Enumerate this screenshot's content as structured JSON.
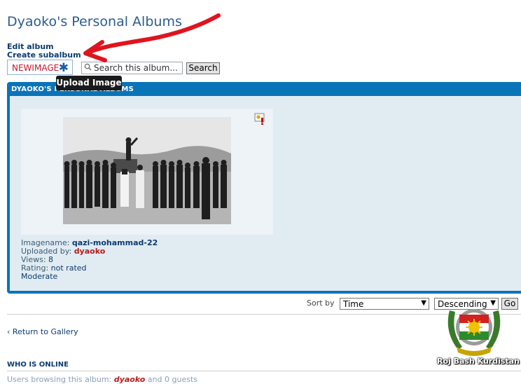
{
  "page": {
    "title": "Dyaoko's Personal Albums"
  },
  "actions": {
    "edit_album": "Edit album",
    "create_subalbum": "Create subalbum",
    "newimage": "NEWIMAGE"
  },
  "search": {
    "placeholder": "Search this album...",
    "button": "Search"
  },
  "tooltip": "Upload Image",
  "panel": {
    "header": "DYAOKO'S PERSONAL ALBUMS"
  },
  "image": {
    "name_label": "Imagename:",
    "name_value": "qazi-mohammad-22",
    "uploaded_label": "Uploaded by:",
    "uploaded_value": "dyaoko",
    "views_label": "Views:",
    "views_value": "8",
    "rating_label": "Rating:",
    "rating_value": "not rated",
    "moderate": "Moderate"
  },
  "sort": {
    "label": "Sort by",
    "field": "Time",
    "order": "Descending",
    "go": "Go"
  },
  "footer": {
    "return_link": "Return to Gallery",
    "who_online": "WHO IS ONLINE",
    "browsing_prefix": "Users browsing this album:",
    "browsing_user": "dyaoko",
    "browsing_suffix": "and 0 guests"
  },
  "overlay": {
    "emblem_text": "Roj Bash Kurdistan"
  },
  "colors": {
    "panel_blue": "#0a74b8",
    "link_blue": "#0b3b6f",
    "accent_red": "#c0172f",
    "annotation_red": "#e0141e"
  }
}
